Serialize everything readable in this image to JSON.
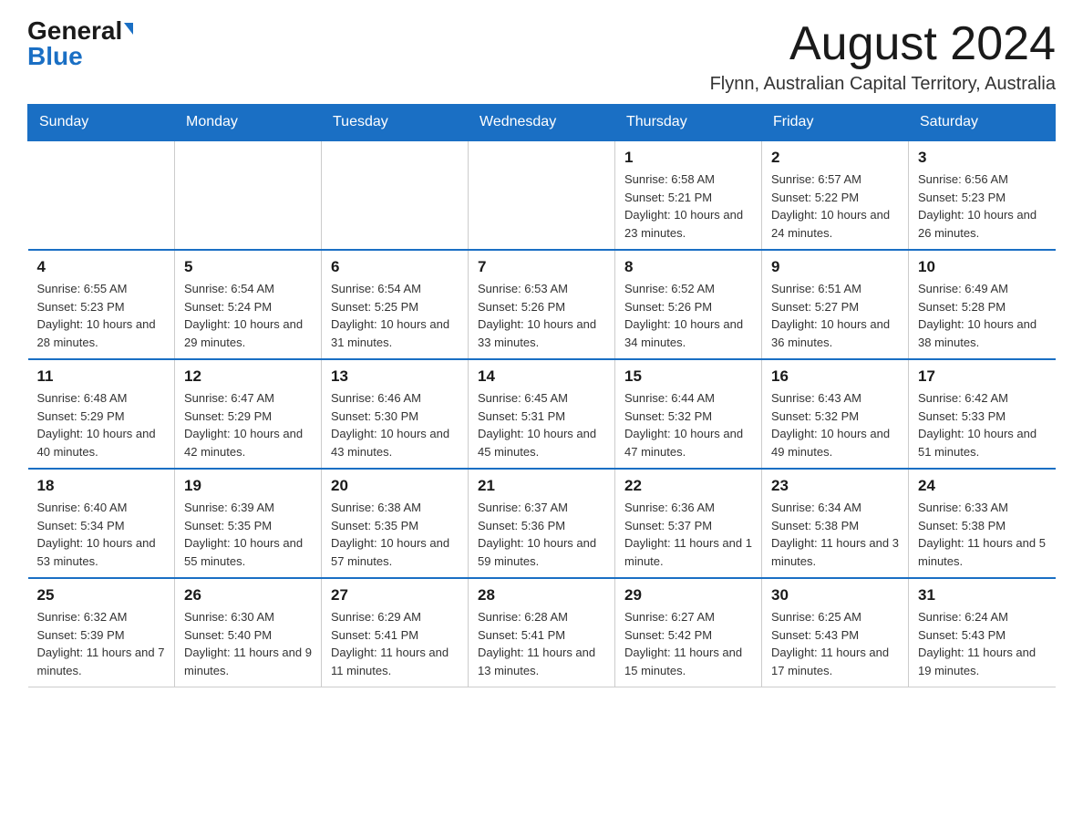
{
  "header": {
    "logo_general": "General",
    "logo_blue": "Blue",
    "month_title": "August 2024",
    "location": "Flynn, Australian Capital Territory, Australia"
  },
  "days_of_week": [
    "Sunday",
    "Monday",
    "Tuesday",
    "Wednesday",
    "Thursday",
    "Friday",
    "Saturday"
  ],
  "weeks": [
    [
      {
        "day": "",
        "sunrise": "",
        "sunset": "",
        "daylight": ""
      },
      {
        "day": "",
        "sunrise": "",
        "sunset": "",
        "daylight": ""
      },
      {
        "day": "",
        "sunrise": "",
        "sunset": "",
        "daylight": ""
      },
      {
        "day": "",
        "sunrise": "",
        "sunset": "",
        "daylight": ""
      },
      {
        "day": "1",
        "sunrise": "Sunrise: 6:58 AM",
        "sunset": "Sunset: 5:21 PM",
        "daylight": "Daylight: 10 hours and 23 minutes."
      },
      {
        "day": "2",
        "sunrise": "Sunrise: 6:57 AM",
        "sunset": "Sunset: 5:22 PM",
        "daylight": "Daylight: 10 hours and 24 minutes."
      },
      {
        "day": "3",
        "sunrise": "Sunrise: 6:56 AM",
        "sunset": "Sunset: 5:23 PM",
        "daylight": "Daylight: 10 hours and 26 minutes."
      }
    ],
    [
      {
        "day": "4",
        "sunrise": "Sunrise: 6:55 AM",
        "sunset": "Sunset: 5:23 PM",
        "daylight": "Daylight: 10 hours and 28 minutes."
      },
      {
        "day": "5",
        "sunrise": "Sunrise: 6:54 AM",
        "sunset": "Sunset: 5:24 PM",
        "daylight": "Daylight: 10 hours and 29 minutes."
      },
      {
        "day": "6",
        "sunrise": "Sunrise: 6:54 AM",
        "sunset": "Sunset: 5:25 PM",
        "daylight": "Daylight: 10 hours and 31 minutes."
      },
      {
        "day": "7",
        "sunrise": "Sunrise: 6:53 AM",
        "sunset": "Sunset: 5:26 PM",
        "daylight": "Daylight: 10 hours and 33 minutes."
      },
      {
        "day": "8",
        "sunrise": "Sunrise: 6:52 AM",
        "sunset": "Sunset: 5:26 PM",
        "daylight": "Daylight: 10 hours and 34 minutes."
      },
      {
        "day": "9",
        "sunrise": "Sunrise: 6:51 AM",
        "sunset": "Sunset: 5:27 PM",
        "daylight": "Daylight: 10 hours and 36 minutes."
      },
      {
        "day": "10",
        "sunrise": "Sunrise: 6:49 AM",
        "sunset": "Sunset: 5:28 PM",
        "daylight": "Daylight: 10 hours and 38 minutes."
      }
    ],
    [
      {
        "day": "11",
        "sunrise": "Sunrise: 6:48 AM",
        "sunset": "Sunset: 5:29 PM",
        "daylight": "Daylight: 10 hours and 40 minutes."
      },
      {
        "day": "12",
        "sunrise": "Sunrise: 6:47 AM",
        "sunset": "Sunset: 5:29 PM",
        "daylight": "Daylight: 10 hours and 42 minutes."
      },
      {
        "day": "13",
        "sunrise": "Sunrise: 6:46 AM",
        "sunset": "Sunset: 5:30 PM",
        "daylight": "Daylight: 10 hours and 43 minutes."
      },
      {
        "day": "14",
        "sunrise": "Sunrise: 6:45 AM",
        "sunset": "Sunset: 5:31 PM",
        "daylight": "Daylight: 10 hours and 45 minutes."
      },
      {
        "day": "15",
        "sunrise": "Sunrise: 6:44 AM",
        "sunset": "Sunset: 5:32 PM",
        "daylight": "Daylight: 10 hours and 47 minutes."
      },
      {
        "day": "16",
        "sunrise": "Sunrise: 6:43 AM",
        "sunset": "Sunset: 5:32 PM",
        "daylight": "Daylight: 10 hours and 49 minutes."
      },
      {
        "day": "17",
        "sunrise": "Sunrise: 6:42 AM",
        "sunset": "Sunset: 5:33 PM",
        "daylight": "Daylight: 10 hours and 51 minutes."
      }
    ],
    [
      {
        "day": "18",
        "sunrise": "Sunrise: 6:40 AM",
        "sunset": "Sunset: 5:34 PM",
        "daylight": "Daylight: 10 hours and 53 minutes."
      },
      {
        "day": "19",
        "sunrise": "Sunrise: 6:39 AM",
        "sunset": "Sunset: 5:35 PM",
        "daylight": "Daylight: 10 hours and 55 minutes."
      },
      {
        "day": "20",
        "sunrise": "Sunrise: 6:38 AM",
        "sunset": "Sunset: 5:35 PM",
        "daylight": "Daylight: 10 hours and 57 minutes."
      },
      {
        "day": "21",
        "sunrise": "Sunrise: 6:37 AM",
        "sunset": "Sunset: 5:36 PM",
        "daylight": "Daylight: 10 hours and 59 minutes."
      },
      {
        "day": "22",
        "sunrise": "Sunrise: 6:36 AM",
        "sunset": "Sunset: 5:37 PM",
        "daylight": "Daylight: 11 hours and 1 minute."
      },
      {
        "day": "23",
        "sunrise": "Sunrise: 6:34 AM",
        "sunset": "Sunset: 5:38 PM",
        "daylight": "Daylight: 11 hours and 3 minutes."
      },
      {
        "day": "24",
        "sunrise": "Sunrise: 6:33 AM",
        "sunset": "Sunset: 5:38 PM",
        "daylight": "Daylight: 11 hours and 5 minutes."
      }
    ],
    [
      {
        "day": "25",
        "sunrise": "Sunrise: 6:32 AM",
        "sunset": "Sunset: 5:39 PM",
        "daylight": "Daylight: 11 hours and 7 minutes."
      },
      {
        "day": "26",
        "sunrise": "Sunrise: 6:30 AM",
        "sunset": "Sunset: 5:40 PM",
        "daylight": "Daylight: 11 hours and 9 minutes."
      },
      {
        "day": "27",
        "sunrise": "Sunrise: 6:29 AM",
        "sunset": "Sunset: 5:41 PM",
        "daylight": "Daylight: 11 hours and 11 minutes."
      },
      {
        "day": "28",
        "sunrise": "Sunrise: 6:28 AM",
        "sunset": "Sunset: 5:41 PM",
        "daylight": "Daylight: 11 hours and 13 minutes."
      },
      {
        "day": "29",
        "sunrise": "Sunrise: 6:27 AM",
        "sunset": "Sunset: 5:42 PM",
        "daylight": "Daylight: 11 hours and 15 minutes."
      },
      {
        "day": "30",
        "sunrise": "Sunrise: 6:25 AM",
        "sunset": "Sunset: 5:43 PM",
        "daylight": "Daylight: 11 hours and 17 minutes."
      },
      {
        "day": "31",
        "sunrise": "Sunrise: 6:24 AM",
        "sunset": "Sunset: 5:43 PM",
        "daylight": "Daylight: 11 hours and 19 minutes."
      }
    ]
  ]
}
